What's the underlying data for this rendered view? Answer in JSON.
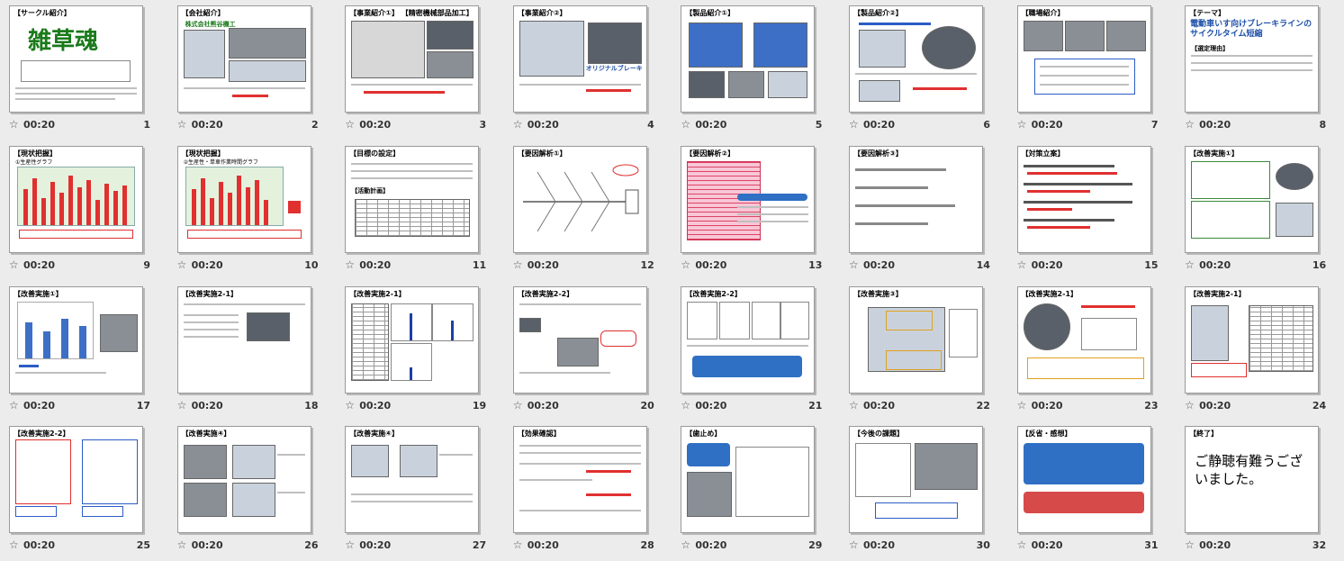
{
  "slides": [
    {
      "num": "1",
      "time": "00:20",
      "title": "【サークル紹介】",
      "heading": "雑草魂"
    },
    {
      "num": "2",
      "time": "00:20",
      "title": "【会社紹介】",
      "heading": "株式会社熊谷機工"
    },
    {
      "num": "3",
      "time": "00:20",
      "title": "【事業紹介①】 【精密機械部品加工】"
    },
    {
      "num": "4",
      "time": "00:20",
      "title": "【事業紹介②】",
      "caption": "オリジナルブレーキ"
    },
    {
      "num": "5",
      "time": "00:20",
      "title": "【製品紹介①】"
    },
    {
      "num": "6",
      "time": "00:20",
      "title": "【製品紹介②】"
    },
    {
      "num": "7",
      "time": "00:20",
      "title": "【職場紹介】"
    },
    {
      "num": "8",
      "time": "00:20",
      "title": "【テーマ】",
      "heading": "電動車いす向けブレーキラインのサイクルタイム短縮",
      "sub": "【選定理由】"
    },
    {
      "num": "9",
      "time": "00:20",
      "title": "【現状把握】",
      "sub": "①生産性グラフ"
    },
    {
      "num": "10",
      "time": "00:20",
      "title": "【現状把握】",
      "sub": "②生産性・単車作業時間グラフ"
    },
    {
      "num": "11",
      "time": "00:20",
      "title": "【目標の設定】",
      "sub": "【活動計画】"
    },
    {
      "num": "12",
      "time": "00:20",
      "title": "【要因解析①】"
    },
    {
      "num": "13",
      "time": "00:20",
      "title": "【要因解析②】"
    },
    {
      "num": "14",
      "time": "00:20",
      "title": "【要因解析③】"
    },
    {
      "num": "15",
      "time": "00:20",
      "title": "【対策立案】"
    },
    {
      "num": "16",
      "time": "00:20",
      "title": "【改善実施①】"
    },
    {
      "num": "17",
      "time": "00:20",
      "title": "【改善実施①】"
    },
    {
      "num": "18",
      "time": "00:20",
      "title": "【改善実施2-1】"
    },
    {
      "num": "19",
      "time": "00:20",
      "title": "【改善実施2-1】"
    },
    {
      "num": "20",
      "time": "00:20",
      "title": "【改善実施2-2】"
    },
    {
      "num": "21",
      "time": "00:20",
      "title": "【改善実施2-2】"
    },
    {
      "num": "22",
      "time": "00:20",
      "title": "【改善実施③】"
    },
    {
      "num": "23",
      "time": "00:20",
      "title": "【改善実施2-1】"
    },
    {
      "num": "24",
      "time": "00:20",
      "title": "【改善実施2-1】"
    },
    {
      "num": "25",
      "time": "00:20",
      "title": "【改善実施2-2】"
    },
    {
      "num": "26",
      "time": "00:20",
      "title": "【改善実施④】"
    },
    {
      "num": "27",
      "time": "00:20",
      "title": "【改善実施④】"
    },
    {
      "num": "28",
      "time": "00:20",
      "title": "【効果確認】"
    },
    {
      "num": "29",
      "time": "00:20",
      "title": "【歯止め】"
    },
    {
      "num": "30",
      "time": "00:20",
      "title": "【今後の課題】"
    },
    {
      "num": "31",
      "time": "00:20",
      "title": "【反省・感想】"
    },
    {
      "num": "32",
      "time": "00:20",
      "title": "【終了】",
      "heading": "ご静聴有難うございました。"
    }
  ]
}
